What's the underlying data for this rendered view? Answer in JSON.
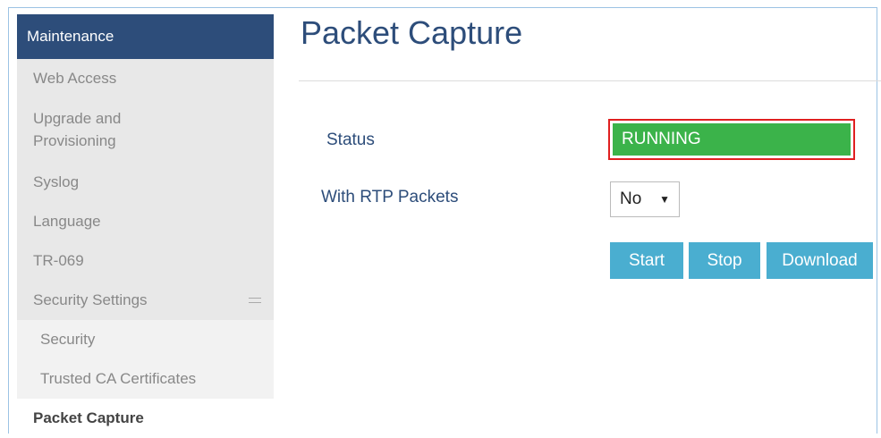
{
  "sidebar": {
    "header": "Maintenance",
    "items": [
      {
        "label": "Web Access"
      },
      {
        "label_line1": "Upgrade and",
        "label_line2": "Provisioning"
      },
      {
        "label": "Syslog"
      },
      {
        "label": "Language"
      },
      {
        "label": "TR-069"
      },
      {
        "label": "Security Settings"
      }
    ],
    "sub_items": [
      "Security",
      "Trusted CA Certificates"
    ],
    "active_item": "Packet Capture"
  },
  "main": {
    "title": "Packet Capture",
    "status_label": "Status",
    "status_value": "RUNNING",
    "rtp_label": "With RTP Packets",
    "rtp_value": "No",
    "buttons": {
      "start": "Start",
      "stop": "Stop",
      "download": "Download"
    }
  },
  "colors": {
    "sidebar_header": "#2d4d7a",
    "status_running": "#3bb34a",
    "status_highlight_border": "#e02020",
    "button": "#4aaed0",
    "title": "#2d4d7a"
  }
}
